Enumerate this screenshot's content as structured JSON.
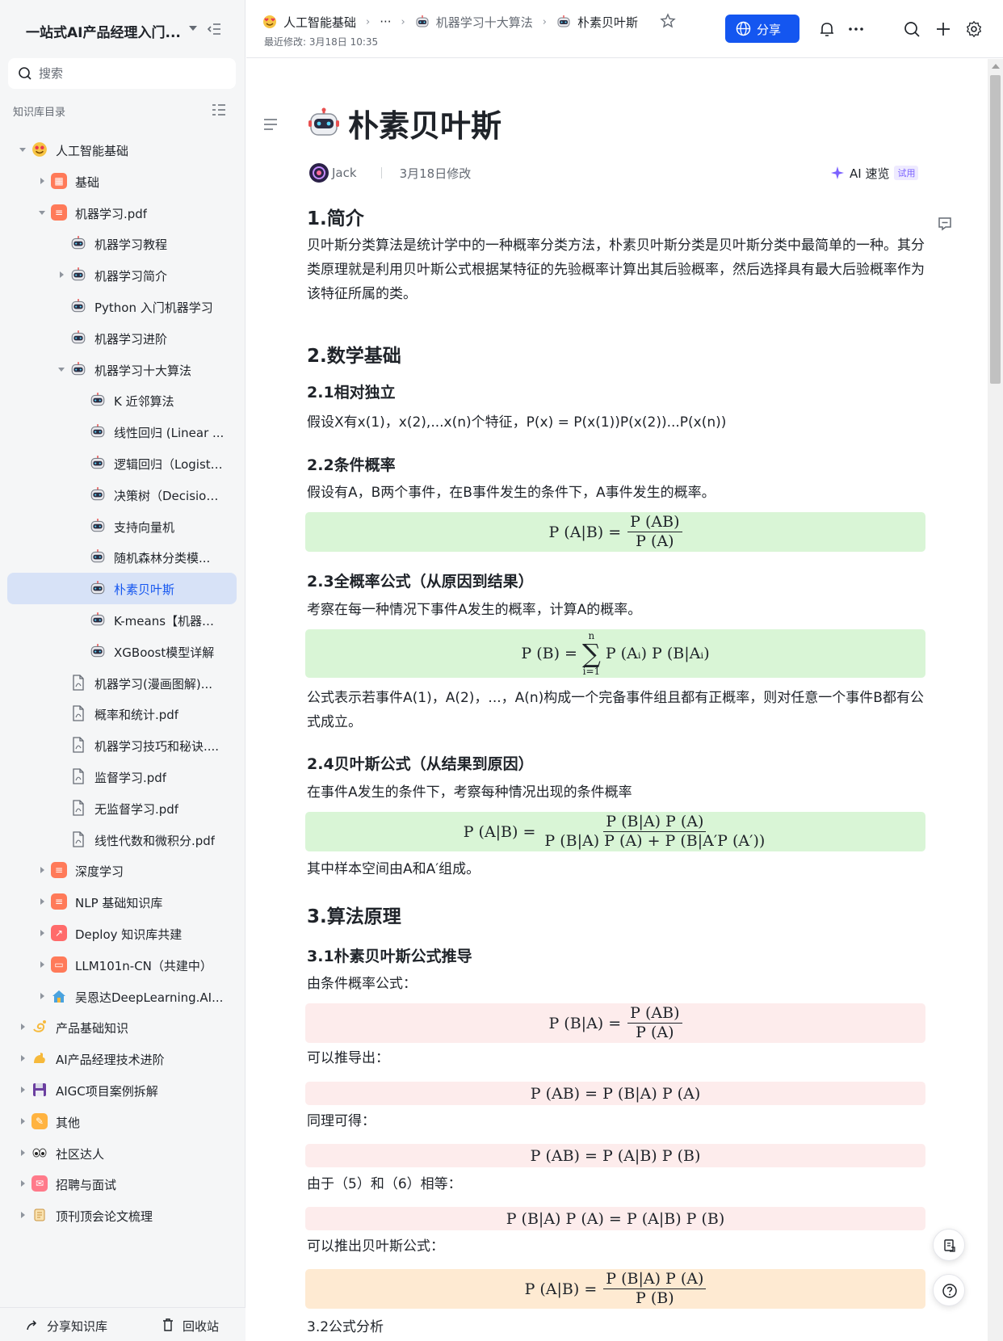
{
  "sidebar": {
    "title": "一站式AI产品经理入门...",
    "search": {
      "placeholder": "搜索"
    },
    "section_label": "知识库目录",
    "tree": [
      {
        "label": "人工智能基础",
        "depth": 0,
        "expanded": true,
        "icon": "heart-eyes-icon"
      },
      {
        "label": "基础",
        "depth": 1,
        "expanded": false,
        "icon": "grid-book-icon"
      },
      {
        "label": "机器学习.pdf",
        "depth": 1,
        "expanded": true,
        "icon": "book-icon"
      },
      {
        "label": "机器学习教程",
        "depth": 2,
        "icon": "robot-icon"
      },
      {
        "label": "机器学习简介",
        "depth": 2,
        "expanded": false,
        "icon": "robot-icon"
      },
      {
        "label": "Python 入门机器学习",
        "depth": 2,
        "icon": "robot-icon"
      },
      {
        "label": "机器学习进阶",
        "depth": 2,
        "icon": "robot-icon"
      },
      {
        "label": "机器学习十大算法",
        "depth": 2,
        "expanded": true,
        "icon": "robot-icon"
      },
      {
        "label": "K 近邻算法",
        "depth": 3,
        "icon": "robot-icon"
      },
      {
        "label": "线性回归 (Linear ...",
        "depth": 3,
        "icon": "robot-icon"
      },
      {
        "label": "逻辑回归（Logisti...",
        "depth": 3,
        "icon": "robot-icon"
      },
      {
        "label": "决策树（Decision...",
        "depth": 3,
        "icon": "robot-icon"
      },
      {
        "label": "支持向量机",
        "depth": 3,
        "icon": "robot-icon"
      },
      {
        "label": "随机森林分类模...",
        "depth": 3,
        "icon": "robot-icon"
      },
      {
        "label": "朴素贝叶斯",
        "depth": 3,
        "icon": "robot-icon",
        "active": true
      },
      {
        "label": "K-means【机器学...",
        "depth": 3,
        "icon": "robot-icon"
      },
      {
        "label": "XGBoost模型详解",
        "depth": 3,
        "icon": "robot-icon"
      },
      {
        "label": "机器学习(漫画图解)...",
        "depth": 2,
        "icon": "pdf-icon"
      },
      {
        "label": "概率和统计.pdf",
        "depth": 2,
        "icon": "pdf-icon"
      },
      {
        "label": "机器学习技巧和秘诀....",
        "depth": 2,
        "icon": "pdf-icon"
      },
      {
        "label": "监督学习.pdf",
        "depth": 2,
        "icon": "pdf-icon"
      },
      {
        "label": "无监督学习.pdf",
        "depth": 2,
        "icon": "pdf-icon"
      },
      {
        "label": "线性代数和微积分.pdf",
        "depth": 2,
        "icon": "pdf-icon"
      },
      {
        "label": "深度学习",
        "depth": 1,
        "expanded": false,
        "icon": "book-icon"
      },
      {
        "label": "NLP 基础知识库",
        "depth": 1,
        "expanded": false,
        "icon": "book-icon"
      },
      {
        "label": "Deploy 知识库共建",
        "depth": 1,
        "expanded": false,
        "icon": "chart-icon"
      },
      {
        "label": "LLM101n-CN（共建中）",
        "depth": 1,
        "expanded": false,
        "icon": "monitor-icon"
      },
      {
        "label": "吴恩达DeepLearning.AI...",
        "depth": 1,
        "expanded": false,
        "icon": "house-icon"
      },
      {
        "label": "产品基础知识",
        "depth": 0,
        "expanded": false,
        "icon": "dizzy-icon"
      },
      {
        "label": "AI产品经理技术进阶",
        "depth": 0,
        "expanded": false,
        "icon": "flex-arm-icon"
      },
      {
        "label": "AIGC项目案例拆解",
        "depth": 0,
        "expanded": false,
        "icon": "floppy-icon"
      },
      {
        "label": "其他",
        "depth": 0,
        "expanded": false,
        "icon": "pencil-box-icon"
      },
      {
        "label": "社区达人",
        "depth": 0,
        "expanded": false,
        "icon": "eyes-icon"
      },
      {
        "label": "招聘与面试",
        "depth": 0,
        "expanded": false,
        "icon": "mail-icon"
      },
      {
        "label": "顶刊顶会论文梳理",
        "depth": 0,
        "expanded": false,
        "icon": "scroll-icon"
      }
    ],
    "footer": {
      "share": "分享知识库",
      "trash": "回收站"
    }
  },
  "topbar": {
    "breadcrumb": [
      {
        "label": "人工智能基础",
        "icon": "heart-eyes-icon"
      },
      {
        "label": "···"
      },
      {
        "label": "机器学习十大算法",
        "icon": "robot-icon"
      },
      {
        "label": "朴素贝叶斯",
        "icon": "robot-icon"
      }
    ],
    "modified": "最近修改: 3月18日 10:35",
    "share_label": "分享"
  },
  "doc": {
    "title": "朴素贝叶斯",
    "author": "Jack",
    "modified": "3月18日修改",
    "ai_read": "AI 速览",
    "ai_badge": "试用",
    "sections": {
      "s1": "1.简介",
      "s1_p": " 贝叶斯分类算法是统计学中的一种概率分类方法，朴素贝叶斯分类是贝叶斯分类中最简单的一种。其分类原理就是利用贝叶斯公式根据某特征的先验概率计算出其后验概率，然后选择具有最大后验概率作为该特征所属的类。",
      "s2": "2.数学基础",
      "s21": "2.1相对独立",
      "s21_p": " 假设X有x(1)，x(2),...x(n)个特征，P(x) = P(x(1))P(x(2))...P(x(n))",
      "s22": "2.2条件概率",
      "s22_p": "假设有A，B两个事件，在B事件发生的条件下，A事件发生的概率。",
      "s23": "2.3全概率公式（从原因到结果）",
      "s23_p": "考察在每一种情况下事件A发生的概率，计算A的概率。",
      "s23_p2": "公式表示若事件A(1)，A(2)，...，A(n)构成一个完备事件组且都有正概率，则对任意一个事件B都有公式成立。",
      "s24": "2.4贝叶斯公式（从结果到原因）",
      "s24_p": "在事件A发生的条件下，考察每种情况出现的条件概率",
      "s24_p2": "其中样本空间由A和A′组成。",
      "s3": "3.算法原理",
      "s31": "3.1朴素贝叶斯公式推导",
      "s31_p1": "由条件概率公式：",
      "s31_p2": "可以推导出：",
      "s31_p3": "同理可得：",
      "s31_p4": "由于（5）和（6）相等：",
      "s31_p5": "可以推出贝叶斯公式：",
      "s32": "3.2公式分析"
    },
    "formulas": {
      "f1_lhs": "P (A|B) =",
      "f1_num": "P (AB)",
      "f1_den": "P (A)",
      "f2_lhs": "P (B) =",
      "f2_top": "n",
      "f2_bot": "i=1",
      "f2_rhs": "P (Aᵢ) P (B|Aᵢ)",
      "f3_lhs": "P (A|B) =",
      "f3_num": "P (B|A) P (A)",
      "f3_den": "P (B|A) P (A) + P (B|A′P (A′))",
      "f4_lhs": "P (B|A) =",
      "f4_num": "P (AB)",
      "f4_den": "P (A)",
      "f5": "P (AB) = P (B|A) P (A)",
      "f6": "P (AB) = P (A|B) P (B)",
      "f7": "P (B|A) P (A) = P (A|B) P (B)",
      "f8_lhs": "P (A|B) =",
      "f8_num": "P (B|A) P (A)",
      "f8_den": "P (B)"
    }
  },
  "colors": {
    "accent": "#1456f0",
    "formula_green": "#d9f5d6",
    "formula_pink": "#fdecec",
    "formula_orange": "#feead2",
    "active_item": "#d7e2f7"
  }
}
